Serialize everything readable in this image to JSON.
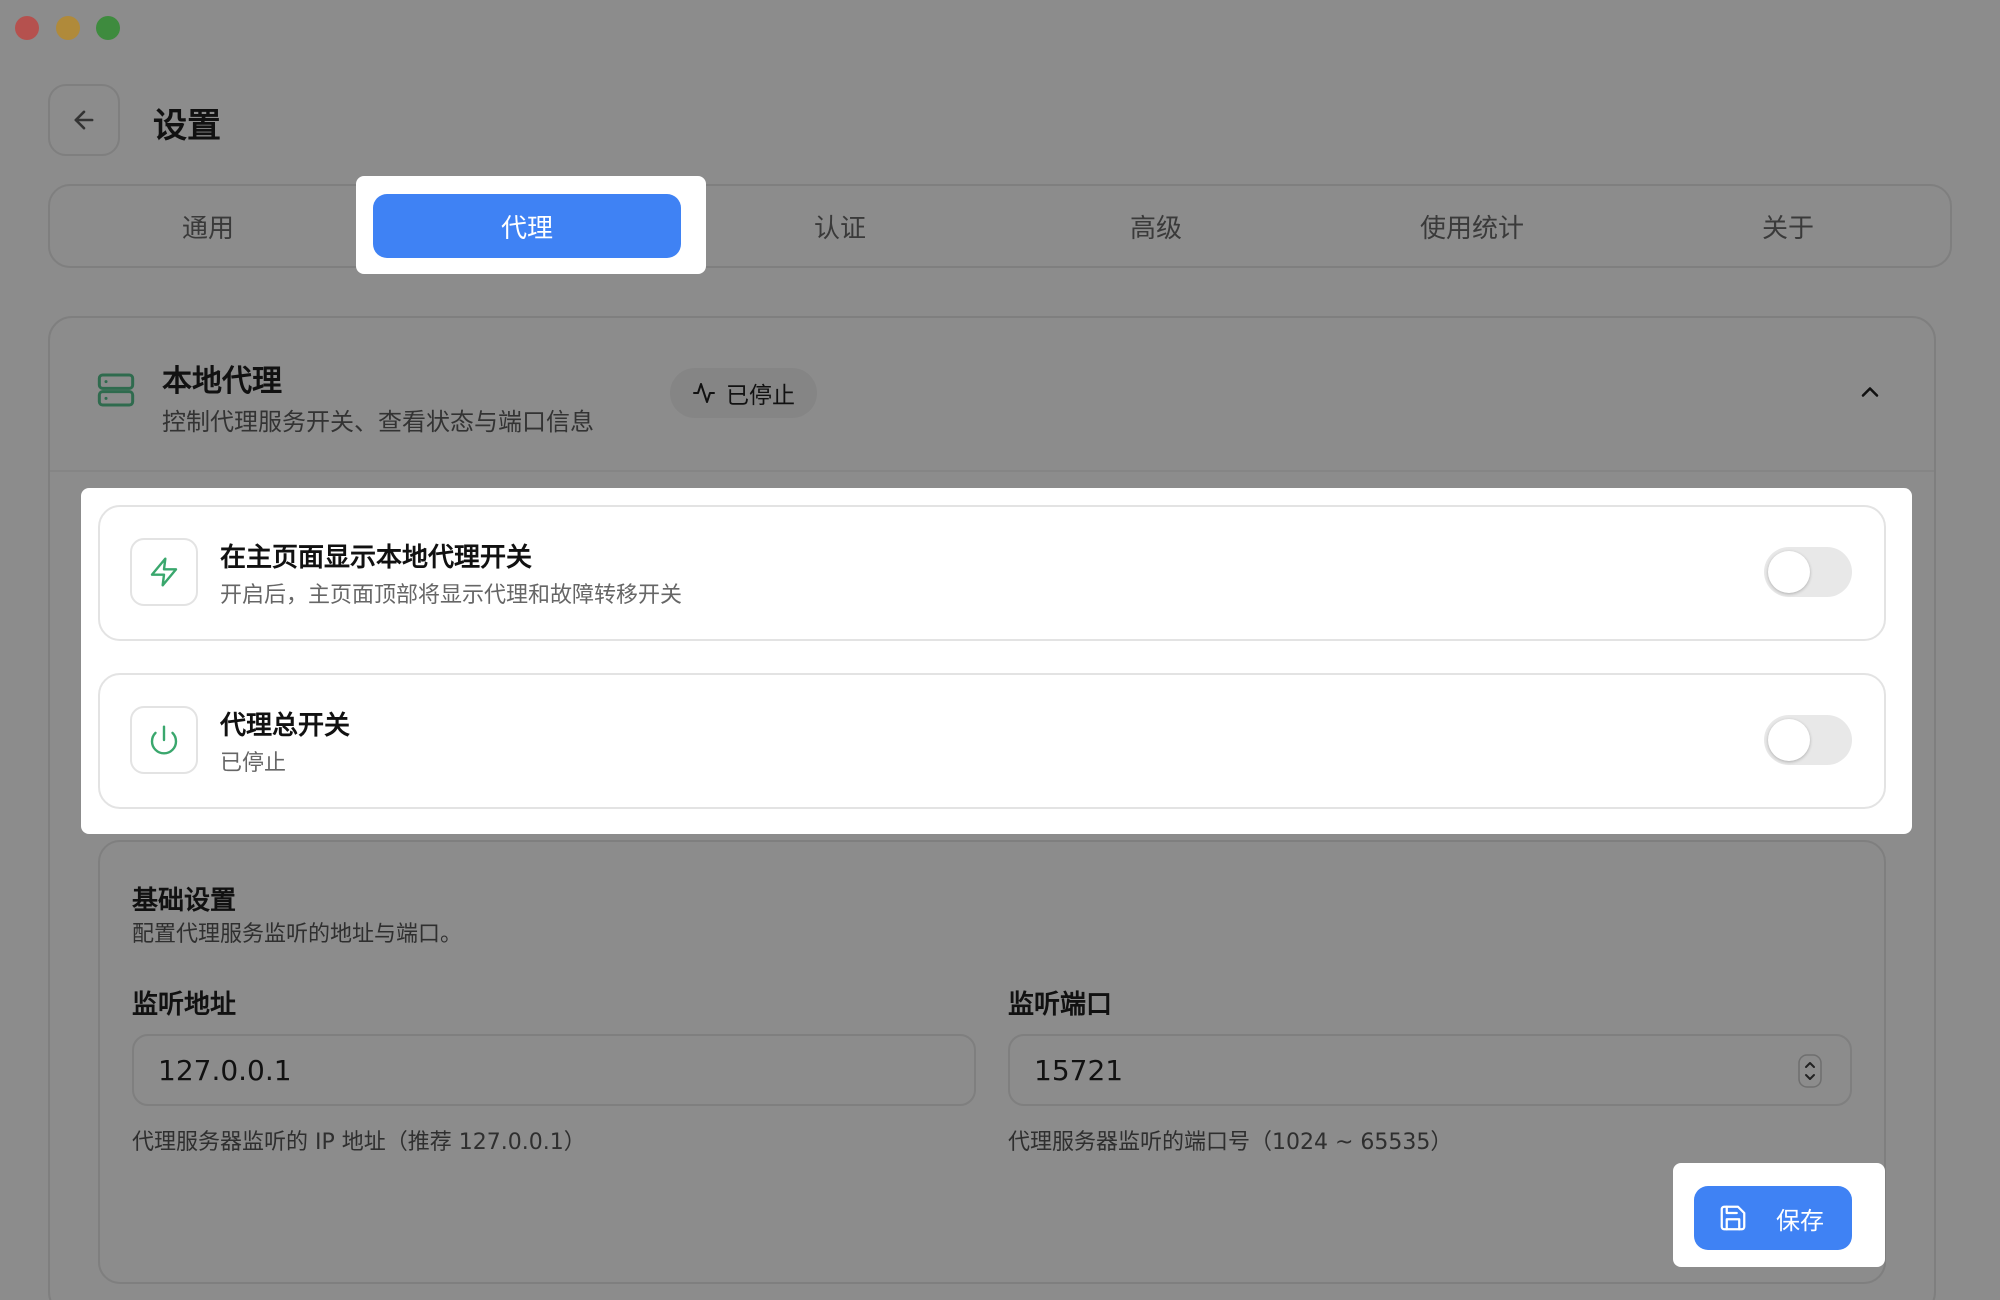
{
  "window": {
    "controls": [
      "close",
      "minimize",
      "zoom"
    ]
  },
  "header": {
    "title": "设置",
    "back_icon": "arrow-left-icon"
  },
  "tabs": [
    {
      "label": "通用"
    },
    {
      "label": "代理",
      "active": true
    },
    {
      "label": "认证"
    },
    {
      "label": "高级"
    },
    {
      "label": "使用统计"
    },
    {
      "label": "关于"
    }
  ],
  "section": {
    "icon": "server-icon",
    "title": "本地代理",
    "subtitle": "控制代理服务开关、查看状态与端口信息",
    "status": {
      "icon": "activity-icon",
      "label": "已停止"
    },
    "collapse_icon": "chevron-up-icon"
  },
  "toggles": [
    {
      "icon": "zap-icon",
      "title": "在主页面显示本地代理开关",
      "subtitle": "开启后，主页面顶部将显示代理和故障转移开关",
      "enabled": false
    },
    {
      "icon": "power-icon",
      "title": "代理总开关",
      "subtitle": "已停止",
      "enabled": false
    }
  ],
  "basic": {
    "title": "基础设置",
    "subtitle": "配置代理服务监听的地址与端口。",
    "address": {
      "label": "监听地址",
      "value": "127.0.0.1",
      "help": "代理服务器监听的 IP 地址（推荐 127.0.0.1）"
    },
    "port": {
      "label": "监听端口",
      "value": "15721",
      "help": "代理服务器监听的端口号（1024 ~ 65535）"
    }
  },
  "save": {
    "label": "保存",
    "icon": "save-icon"
  },
  "colors": {
    "accent": "#3f82f4",
    "icon_green": "#3aa76d",
    "overlay": "#8c8c8c"
  }
}
